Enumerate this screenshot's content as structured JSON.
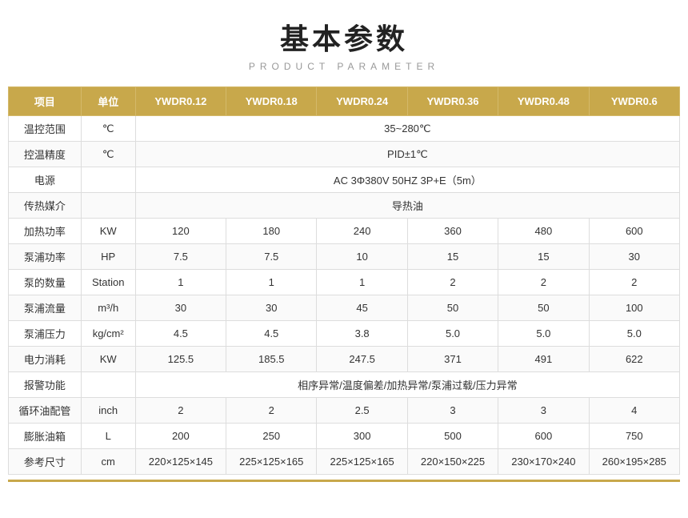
{
  "header": {
    "title": "基本参数",
    "subtitle": "PRODUCT PARAMETER"
  },
  "table": {
    "columns": [
      "项目",
      "单位",
      "YWDR0.12",
      "YWDR0.18",
      "YWDR0.24",
      "YWDR0.36",
      "YWDR0.48",
      "YWDR0.6"
    ],
    "rows": [
      {
        "item": "温控范围",
        "unit": "℃",
        "merged": true,
        "mergedValue": "35~280℃"
      },
      {
        "item": "控温精度",
        "unit": "℃",
        "merged": true,
        "mergedValue": "PID±1℃"
      },
      {
        "item": "电源",
        "unit": "",
        "merged": true,
        "mergedValue": "AC 3Φ380V 50HZ 3P+E（5m）"
      },
      {
        "item": "传热媒介",
        "unit": "",
        "merged": true,
        "mergedValue": "导热油"
      },
      {
        "item": "加热功率",
        "unit": "KW",
        "merged": false,
        "values": [
          "120",
          "180",
          "240",
          "360",
          "480",
          "600"
        ]
      },
      {
        "item": "泵浦功率",
        "unit": "HP",
        "merged": false,
        "values": [
          "7.5",
          "7.5",
          "10",
          "15",
          "15",
          "30"
        ]
      },
      {
        "item": "泵的数量",
        "unit": "Station",
        "merged": false,
        "values": [
          "1",
          "1",
          "1",
          "2",
          "2",
          "2"
        ]
      },
      {
        "item": "泵浦流量",
        "unit": "m³/h",
        "merged": false,
        "values": [
          "30",
          "30",
          "45",
          "50",
          "50",
          "100"
        ]
      },
      {
        "item": "泵浦压力",
        "unit": "kg/cm²",
        "merged": false,
        "values": [
          "4.5",
          "4.5",
          "3.8",
          "5.0",
          "5.0",
          "5.0"
        ]
      },
      {
        "item": "电力消耗",
        "unit": "KW",
        "merged": false,
        "values": [
          "125.5",
          "185.5",
          "247.5",
          "371",
          "491",
          "622"
        ]
      },
      {
        "item": "报警功能",
        "unit": "",
        "merged": true,
        "mergedValue": "相序异常/温度偏差/加热异常/泵浦过载/压力异常"
      },
      {
        "item": "循环油配管",
        "unit": "inch",
        "merged": false,
        "values": [
          "2",
          "2",
          "2.5",
          "3",
          "3",
          "4"
        ]
      },
      {
        "item": "膨胀油箱",
        "unit": "L",
        "merged": false,
        "values": [
          "200",
          "250",
          "300",
          "500",
          "600",
          "750"
        ]
      },
      {
        "item": "参考尺寸",
        "unit": "cm",
        "merged": false,
        "values": [
          "220×125×145",
          "225×125×165",
          "225×125×165",
          "220×150×225",
          "230×170×240",
          "260×195×285"
        ]
      }
    ]
  }
}
